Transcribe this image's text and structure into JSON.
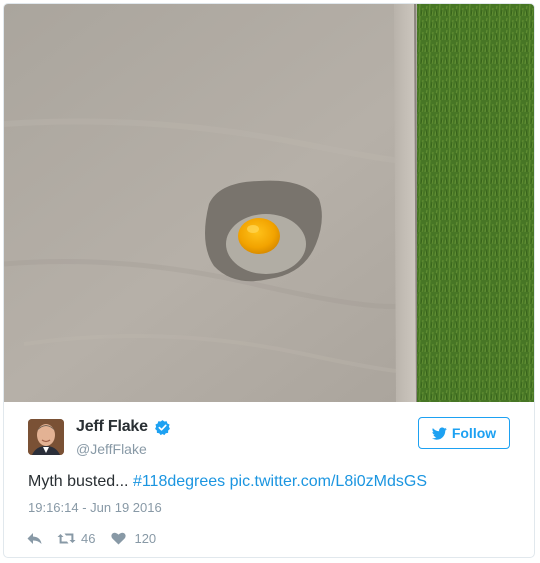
{
  "photo": {
    "icon": "photo-egg-on-sidewalk",
    "colors": {
      "concrete": "#b2aca4",
      "grass": "#4b7b28",
      "yolk": "#f2a800"
    }
  },
  "author": {
    "name": "Jeff Flake",
    "handle": "@JeffFlake",
    "verified_icon": "verified-badge-icon"
  },
  "follow_button": {
    "label": "Follow",
    "icon": "twitter-bird-icon"
  },
  "tweet": {
    "text": "Myth busted... ",
    "hashtag": "#118degrees",
    "link": "pic.twitter.com/L8i0zMdsGS"
  },
  "timestamp": "19:16:14 - Jun 19 2016",
  "actions": {
    "retweet_count": "46",
    "like_count": "120"
  },
  "colors": {
    "accent": "#1da1f2",
    "link": "#1b95e0",
    "muted": "#8899a6",
    "text": "#292f33"
  }
}
